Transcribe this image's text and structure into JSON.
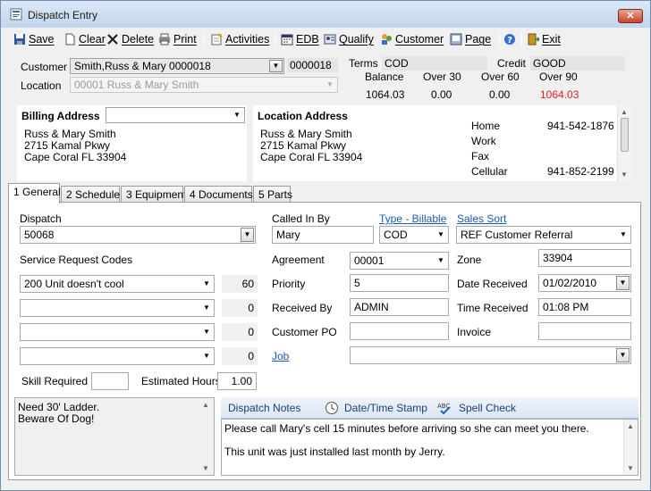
{
  "window": {
    "title": "Dispatch Entry",
    "close_icon": "close-icon"
  },
  "toolbar": {
    "save": "Save",
    "clear": "Clear",
    "delete": "Delete",
    "print": "Print",
    "activities": "Activities",
    "edb": "EDB",
    "qualify": "Qualify",
    "customer": "Customer",
    "page": "Page",
    "exit": "Exit"
  },
  "header": {
    "customer_label": "Customer",
    "customer_value": "Smith,Russ & Mary 0000018",
    "customer_id": "0000018",
    "location_label": "Location",
    "location_value": "00001 Russ & Mary Smith",
    "terms_label": "Terms",
    "terms_value": "COD",
    "credit_label": "Credit",
    "credit_value": "GOOD",
    "aging_headers": [
      "Balance",
      "Over 30",
      "Over 60",
      "Over 90"
    ],
    "aging_values": [
      "1064.03",
      "0.00",
      "0.00",
      "1064.03"
    ],
    "over90_color": "#e02020"
  },
  "billing": {
    "title": "Billing Address",
    "lines": [
      "Russ & Mary Smith",
      "2715 Kamal Pkwy",
      "Cape Coral FL  33904"
    ]
  },
  "location_address": {
    "title": "Location Address",
    "lines": [
      "Russ & Mary Smith",
      "2715 Kamal Pkwy",
      "Cape Coral FL  33904"
    ],
    "phones": [
      {
        "label": "Home",
        "value": "941-542-1876"
      },
      {
        "label": "Work",
        "value": ""
      },
      {
        "label": "Fax",
        "value": ""
      },
      {
        "label": "Cellular",
        "value": "941-852-2199"
      }
    ]
  },
  "tabs": [
    "1 General",
    "2 Schedule",
    "3 Equipment",
    "4 Documents",
    "5 Parts"
  ],
  "general": {
    "dispatch_label": "Dispatch",
    "dispatch_value": "50068",
    "called_in_by_label": "Called In By",
    "called_in_by_value": "Mary",
    "type_label": "Type - Billable",
    "type_value": "COD",
    "sales_sort_label": "Sales Sort",
    "sales_sort_value": "REF Customer Referral",
    "src_label": "Service Request Codes",
    "src_rows": [
      {
        "code": "200 Unit doesn't cool",
        "qty": "60"
      },
      {
        "code": "",
        "qty": "0"
      },
      {
        "code": "",
        "qty": "0"
      },
      {
        "code": "",
        "qty": "0"
      }
    ],
    "agreement_label": "Agreement",
    "agreement_value": "00001",
    "zone_label": "Zone",
    "zone_value": "33904",
    "priority_label": "Priority",
    "priority_value": "5",
    "date_received_label": "Date Received",
    "date_received_value": "01/02/2010",
    "received_by_label": "Received By",
    "received_by_value": "ADMIN",
    "time_received_label": "Time Received",
    "time_received_value": "01:08 PM",
    "customer_po_label": "Customer PO",
    "customer_po_value": "",
    "invoice_label": "Invoice",
    "invoice_value": "",
    "job_label": "Job",
    "job_value": "",
    "skill_label": "Skill Required",
    "skill_value": "",
    "est_hours_label": "Estimated Hours",
    "est_hours_value": "1.00",
    "location_notes": [
      "Need 30' Ladder.",
      "Beware Of Dog!"
    ],
    "notes_tab": "Dispatch Notes",
    "datetime_stamp": "Date/Time Stamp",
    "spell_check": "Spell Check",
    "dispatch_notes": [
      "Please call Mary's cell 15 minutes before arriving so she can meet you there.",
      "This unit was just installed last month by Jerry."
    ]
  }
}
